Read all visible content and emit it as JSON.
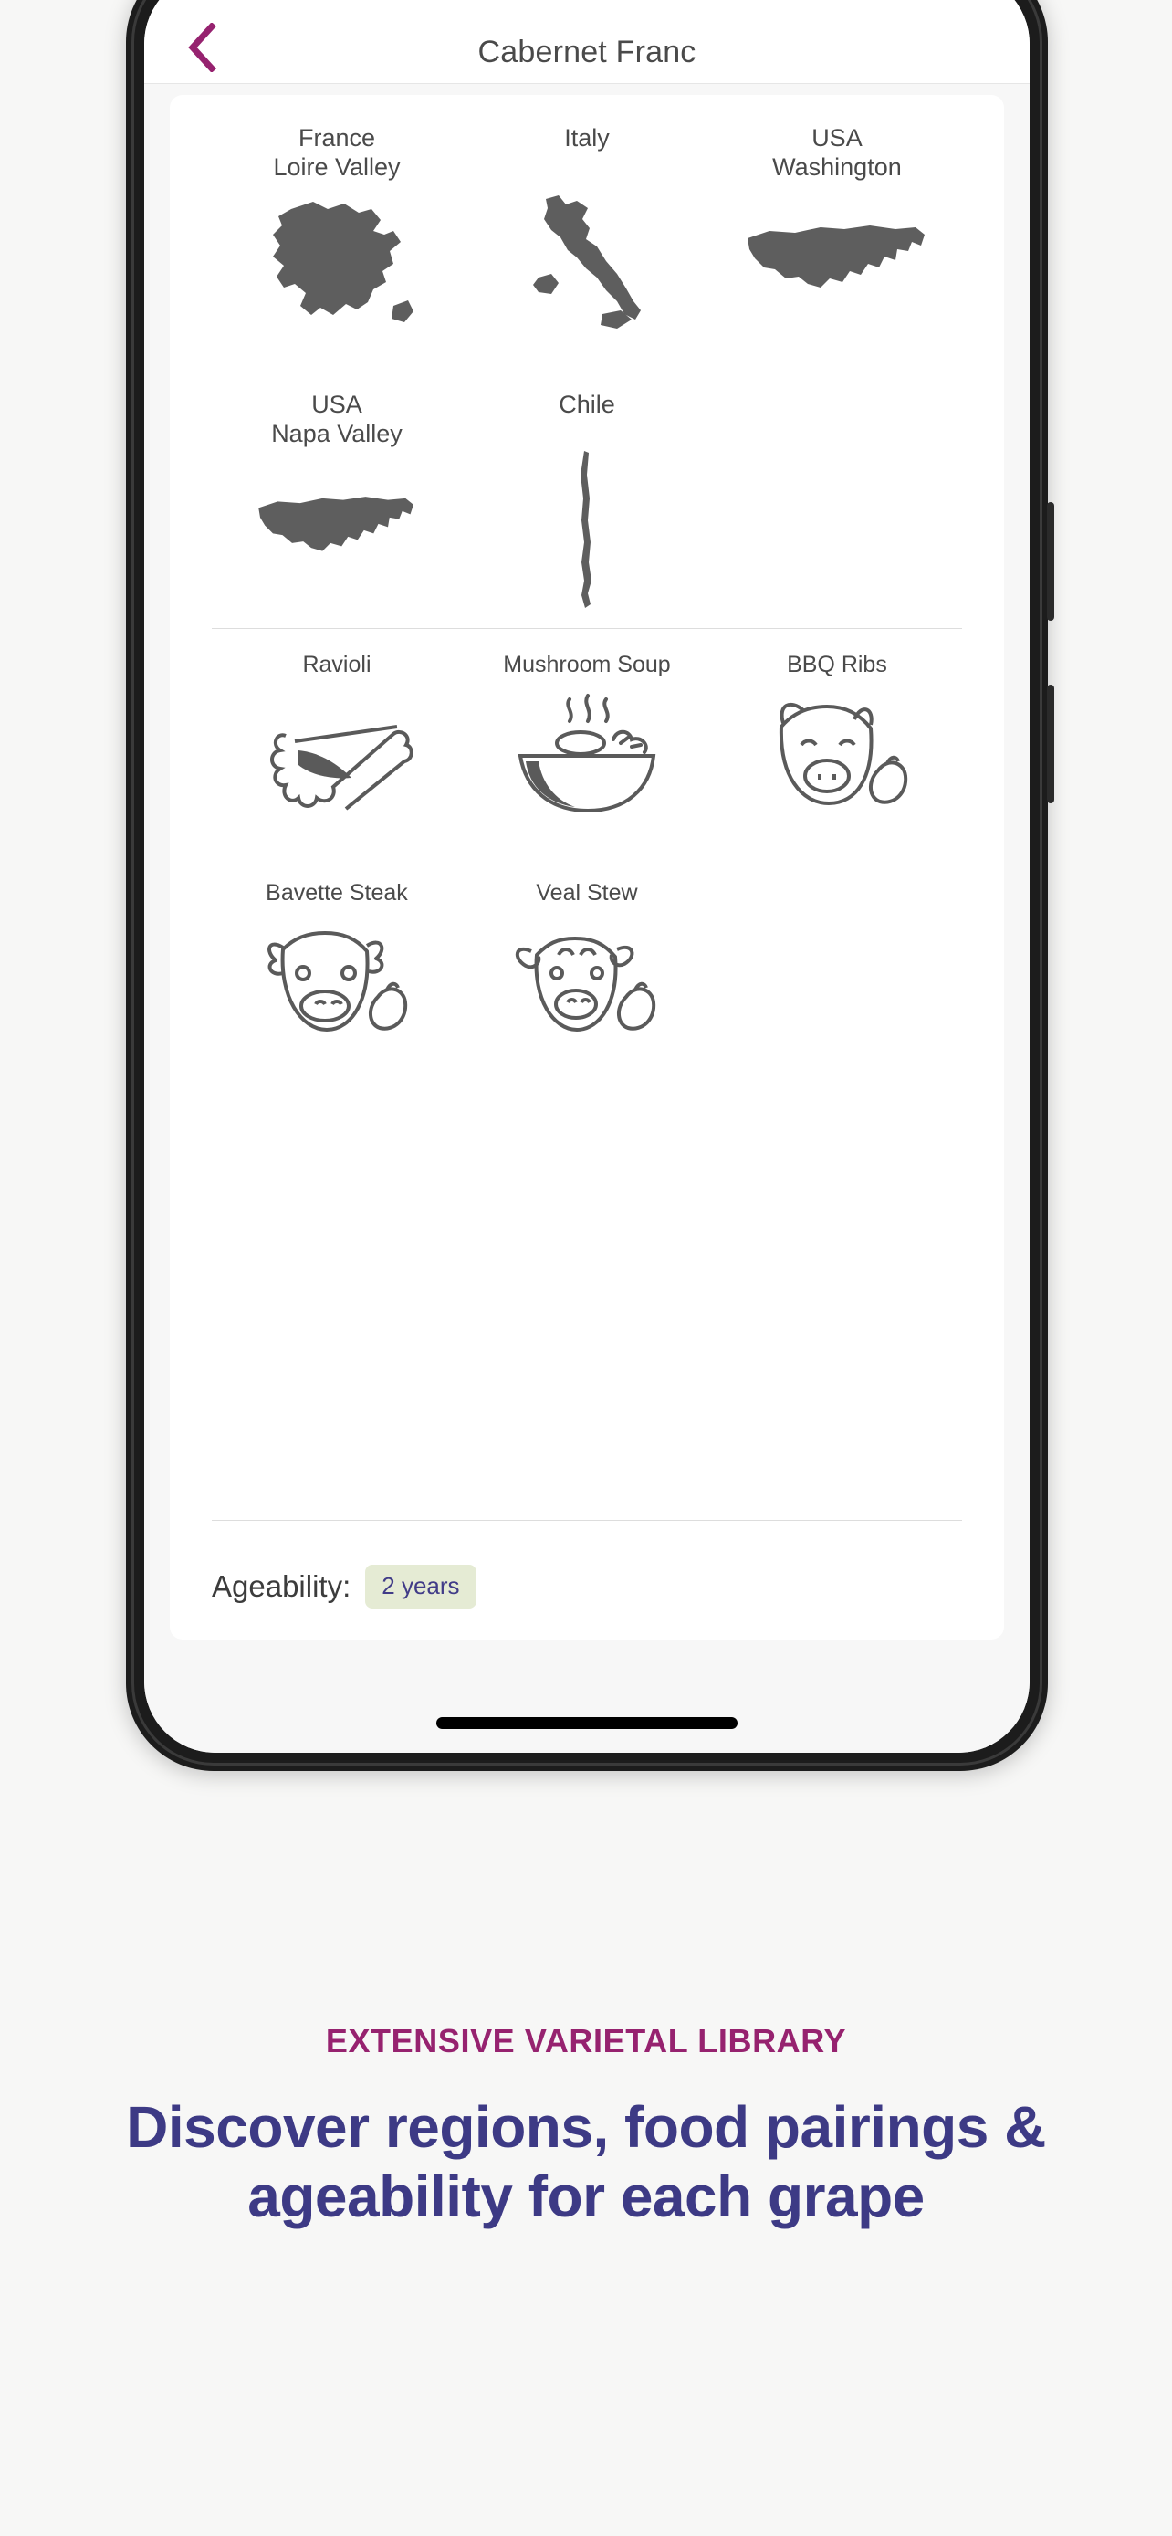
{
  "nav": {
    "back_icon": "chevron-left-icon",
    "title": "Cabernet Franc",
    "back_color": "#96226f"
  },
  "regions": [
    {
      "label": "France\nLoire Valley",
      "map": "france-map"
    },
    {
      "label": "Italy",
      "map": "italy-map"
    },
    {
      "label": "USA\nWashington",
      "map": "usa-map"
    },
    {
      "label": "USA\nNapa Valley",
      "map": "usa-map"
    },
    {
      "label": "Chile",
      "map": "chile-map"
    }
  ],
  "food_pairings": [
    {
      "label": "Ravioli",
      "icon": "ravioli-icon"
    },
    {
      "label": "Mushroom Soup",
      "icon": "soup-bowl-icon"
    },
    {
      "label": "BBQ Ribs",
      "icon": "pig-head-icon"
    },
    {
      "label": "Bavette Steak",
      "icon": "cow-head-icon"
    },
    {
      "label": "Veal Stew",
      "icon": "calf-head-icon"
    }
  ],
  "ageability": {
    "label": "Ageability:",
    "value": "2 years",
    "badge_bg": "#e5ebd4",
    "badge_text_color": "#413c88"
  },
  "marketing": {
    "eyebrow": "EXTENSIVE VARIETAL LIBRARY",
    "eyebrow_color": "#96226f",
    "headline": "Discover regions, food pairings & ageability for each grape",
    "headline_color": "#3d3a85"
  },
  "colors": {
    "page_background": "#f7f7f6",
    "card_background": "#ffffff",
    "map_fill": "#5e5e5e",
    "icon_stroke": "#5a5a5a",
    "text_primary": "#4a4a4a"
  }
}
